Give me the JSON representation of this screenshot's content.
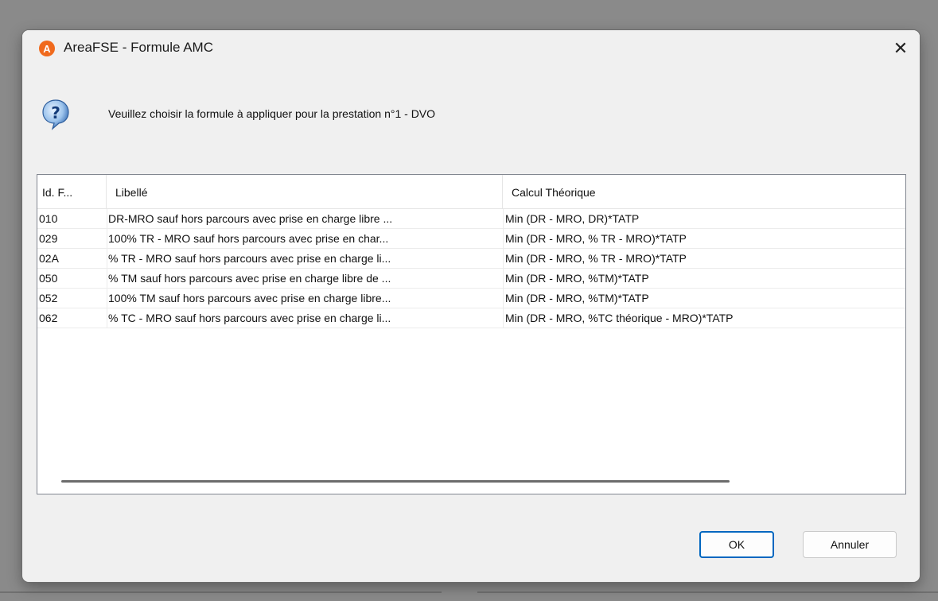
{
  "window": {
    "title": "AreaFSE - Formule AMC",
    "app_icon_letter": "A",
    "close_symbol": "✕"
  },
  "prompt": {
    "icon": "question-icon",
    "text": "Veuillez choisir la formule à appliquer pour la prestation n°1 - DVO"
  },
  "table": {
    "columns": [
      "Id. F...",
      "Libellé",
      "Calcul Théorique"
    ],
    "rows": [
      {
        "id": "010",
        "libelle": "DR-MRO sauf hors parcours avec prise en charge libre ...",
        "calcul": "Min (DR - MRO, DR)*TATP"
      },
      {
        "id": "029",
        "libelle": "100% TR - MRO sauf hors parcours avec prise en char...",
        "calcul": "Min (DR - MRO, % TR - MRO)*TATP"
      },
      {
        "id": "02A",
        "libelle": "% TR - MRO sauf hors parcours avec prise en charge li...",
        "calcul": "Min (DR - MRO, % TR - MRO)*TATP"
      },
      {
        "id": "050",
        "libelle": "% TM sauf hors parcours avec prise en charge libre de ...",
        "calcul": "Min (DR - MRO, %TM)*TATP"
      },
      {
        "id": "052",
        "libelle": "100% TM sauf hors parcours avec prise en charge libre...",
        "calcul": "Min (DR - MRO, %TM)*TATP"
      },
      {
        "id": "062",
        "libelle": "% TC - MRO sauf hors parcours avec prise en charge li...",
        "calcul": "Min (DR - MRO, %TC théorique - MRO)*TATP"
      }
    ]
  },
  "buttons": {
    "ok": "OK",
    "cancel": "Annuler"
  },
  "colors": {
    "accent": "#0067c0",
    "app_icon": "#f06a1d"
  }
}
